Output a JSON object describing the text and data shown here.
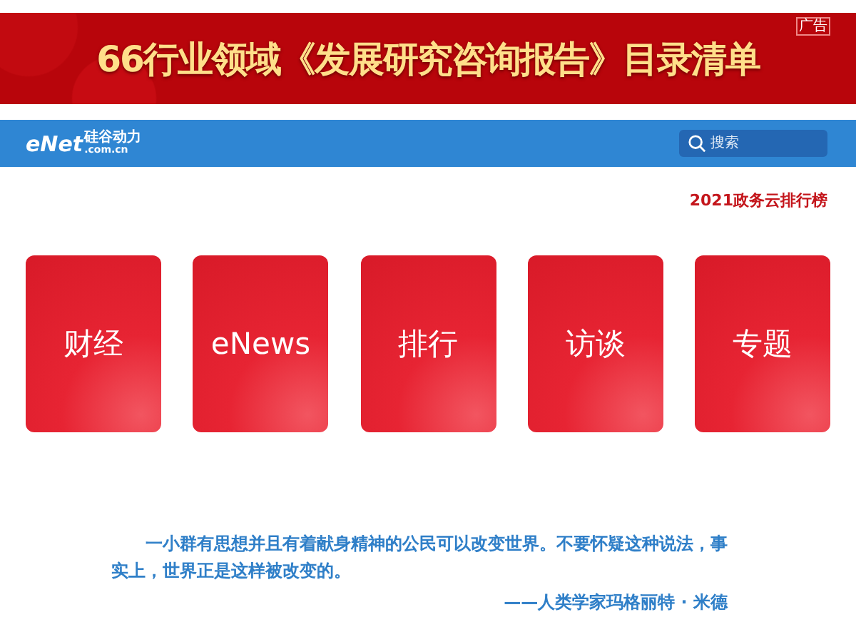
{
  "banner": {
    "title": "66行业领域《发展研究咨询报告》目录清单",
    "ad_label": "广告"
  },
  "navbar": {
    "logo": {
      "brand": "eNet",
      "cn": "硅谷动力",
      "domain": ".com.cn"
    },
    "search": {
      "placeholder": "搜索"
    }
  },
  "ranking_link": "2021政务云排行榜",
  "tiles": [
    {
      "label": "财经"
    },
    {
      "label": "eNews"
    },
    {
      "label": "排行"
    },
    {
      "label": "访谈"
    },
    {
      "label": "专题"
    }
  ],
  "quote": {
    "text": "一小群有思想并且有着献身精神的公民可以改变世界。不要怀疑这种说法，事实上，世界正是这样被改变的。",
    "author": "——人类学家玛格丽特 · 米德"
  }
}
